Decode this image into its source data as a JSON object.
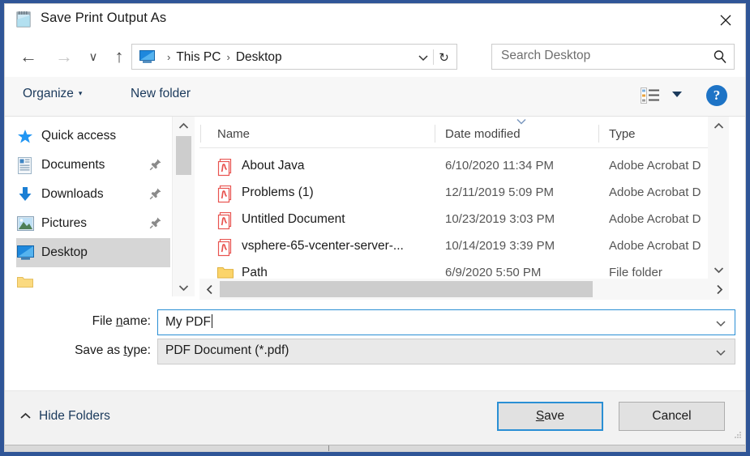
{
  "window": {
    "title": "Save Print Output As",
    "icon": "notepad-icon",
    "close_label": "✕",
    "frame_color": "#2f5597"
  },
  "navbar": {
    "back_icon": "←",
    "forward_icon": "→",
    "recent_icon": "∨",
    "up_icon": "↑",
    "breadcrumb": {
      "icon": "this-pc-monitor-icon",
      "items": [
        "This PC",
        "Desktop"
      ],
      "separator": "›",
      "dropdown_icon": "∨",
      "refresh_icon": "↻"
    },
    "search": {
      "placeholder": "Search Desktop",
      "icon": "search-magnifier-icon"
    }
  },
  "toolbar": {
    "organize_label": "Organize",
    "organize_caret": "▾",
    "new_folder_label": "New folder",
    "view_icon": "view-options-icon",
    "view_caret": "▾",
    "help_label": "?"
  },
  "sidebar": {
    "items": [
      {
        "label": "Quick access",
        "icon": "star-icon",
        "pinned": false,
        "selected": false
      },
      {
        "label": "Documents",
        "icon": "documents-icon",
        "pinned": true,
        "selected": false
      },
      {
        "label": "Downloads",
        "icon": "downloads-arrow-icon",
        "pinned": true,
        "selected": false
      },
      {
        "label": "Pictures",
        "icon": "pictures-icon",
        "pinned": true,
        "selected": false
      },
      {
        "label": "Desktop",
        "icon": "desktop-monitor-icon",
        "pinned": false,
        "selected": true
      }
    ],
    "scroll_up_icon": "∧",
    "scroll_down_icon": "∨"
  },
  "filelist": {
    "columns": [
      {
        "label": "Name",
        "sorted": false
      },
      {
        "label": "Date modified",
        "sorted": true
      },
      {
        "label": "Type",
        "sorted": false
      }
    ],
    "sort_indicator": "∨",
    "rows": [
      {
        "name": "About Java",
        "date": "6/10/2020 11:34 PM",
        "type": "Adobe Acrobat D",
        "icon": "pdf-file-icon"
      },
      {
        "name": "Problems (1)",
        "date": "12/11/2019 5:09 PM",
        "type": "Adobe Acrobat D",
        "icon": "pdf-file-icon"
      },
      {
        "name": "Untitled Document",
        "date": "10/23/2019 3:03 PM",
        "type": "Adobe Acrobat D",
        "icon": "pdf-file-icon"
      },
      {
        "name": "vsphere-65-vcenter-server-...",
        "date": "10/14/2019 3:39 PM",
        "type": "Adobe Acrobat D",
        "icon": "pdf-file-icon"
      },
      {
        "name": "Path",
        "date": "6/9/2020 5:50 PM",
        "type": "File folder",
        "icon": "folder-icon"
      }
    ],
    "scroll_up_icon": "∧",
    "scroll_down_icon": "∨",
    "scroll_left_icon": "‹",
    "scroll_right_icon": "›"
  },
  "form": {
    "filename_label_pre": "File ",
    "filename_label_accel": "n",
    "filename_label_post": "ame:",
    "filename_value": "My PDF",
    "savetype_label_pre": "Save as ",
    "savetype_label_accel": "t",
    "savetype_label_post": "ype:",
    "savetype_value": "PDF Document (*.pdf)",
    "chevron": "∨"
  },
  "footer": {
    "hide_folders_caret": "∧",
    "hide_folders_label": "Hide Folders",
    "save_pre": "",
    "save_accel": "S",
    "save_post": "ave",
    "cancel_label": "Cancel",
    "focus_color": "#2a8fd4"
  }
}
